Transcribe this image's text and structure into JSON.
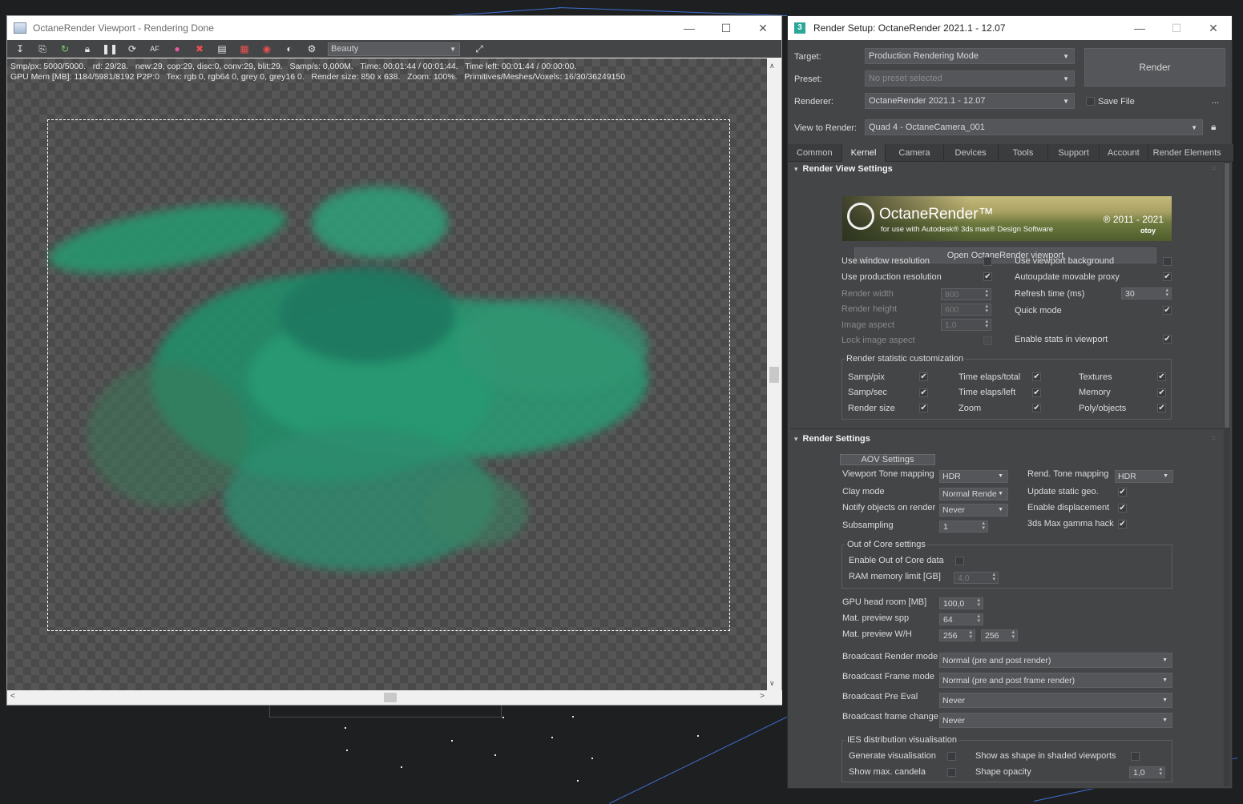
{
  "viewport": {
    "title": "OctaneRender Viewport - Rendering Done",
    "pass_select": "Beauty",
    "stats_line1": "Smp/px: 5000/5000.   rd: 29/28.   new:29, cop:29, disc:0, conv:29, blit:29.   Samp/s: 0,000M.   Time: 00:01:44 / 00:01:44.   Time left: 00:01:44 / 00:00:00.",
    "stats_line2": "GPU Mem [MB]: 1184/5981/8192 P2P:0   Tex: rgb 0, rgb64 0, grey 0, grey16 0.   Render size: 850 x 638.   Zoom: 100%.   Primitives/Meshes/Voxels: 16/30/36249150",
    "toolbar_icons": [
      "save-icon",
      "copy-icon",
      "refresh-icon",
      "lock-icon",
      "pause-icon",
      "restart-icon",
      "aa-icon",
      "color-icon",
      "region-icon",
      "display-icon",
      "film-icon",
      "camera-icon",
      "material-icon",
      "settings-icon",
      "zoom-fit-icon"
    ]
  },
  "render_setup": {
    "title": "Render Setup: OctaneRender 2021.1 - 12.07",
    "target_label": "Target:",
    "target_value": "Production Rendering Mode",
    "preset_label": "Preset:",
    "preset_value": "No preset selected",
    "renderer_label": "Renderer:",
    "renderer_value": "OctaneRender 2021.1 - 12.07",
    "view_label": "View to Render:",
    "view_value": "Quad 4 - OctaneCamera_001",
    "render_button": "Render",
    "save_file": "Save File",
    "more": "...",
    "tabs": [
      "Common",
      "Kernel",
      "Camera",
      "Devices",
      "Tools",
      "Support",
      "Account",
      "Render Elements"
    ],
    "active_tab": "Kernel",
    "rv_section": "Render View Settings",
    "banner_title": "OctaneRender™",
    "banner_sub": "for use with Autodesk® 3ds max® Design Software",
    "banner_years": "® 2011 - 2021",
    "banner_brand": "otoy",
    "open_viewport": "Open OctaneRender viewport",
    "rv": {
      "use_window_res": "Use window resolution",
      "use_prod_res": "Use production resolution",
      "render_width": "Render width",
      "render_width_val": "800",
      "render_height": "Render height",
      "render_height_val": "600",
      "image_aspect": "Image aspect",
      "image_aspect_val": "1,0",
      "lock_aspect": "Lock image aspect",
      "use_vp_bg": "Use viewport background",
      "autoupdate": "Autoupdate movable proxy",
      "refresh_time": "Refresh time (ms)",
      "refresh_val": "30",
      "quick_mode": "Quick mode",
      "enable_stats": "Enable stats in viewport"
    },
    "stat_group": "Render statistic customization",
    "stats": {
      "samp_pix": "Samp/pix",
      "samp_sec": "Samp/sec",
      "render_size": "Render size",
      "time_total": "Time elaps/total",
      "time_left": "Time elaps/left",
      "zoom": "Zoom",
      "textures": "Textures",
      "memory": "Memory",
      "poly": "Poly/objects"
    },
    "rs_section": "Render Settings",
    "aov": "AOV Settings",
    "rs": {
      "vp_tone": "Viewport Tone mapping",
      "vp_tone_val": "HDR",
      "clay": "Clay mode",
      "clay_val": "Normal Rende",
      "notify": "Notify objects on render",
      "notify_val": "Never",
      "subsampling": "Subsampling",
      "subsampling_val": "1",
      "rend_tone": "Rend. Tone mapping",
      "rend_tone_val": "HDR",
      "update_static": "Update static geo.",
      "enable_disp": "Enable displacement",
      "gamma_hack": "3ds Max gamma hack"
    },
    "ooc_group": "Out of Core settings",
    "ooc_enable": "Enable Out of Core data",
    "ooc_ram": "RAM memory limit [GB]",
    "ooc_ram_val": "4,0",
    "gpu_headroom": "GPU head room [MB]",
    "gpu_headroom_val": "100,0",
    "mat_spp": "Mat. preview spp",
    "mat_spp_val": "64",
    "mat_wh": "Mat. preview W/H",
    "mat_w_val": "256",
    "mat_h_val": "256",
    "bc_render": "Broadcast Render mode",
    "bc_render_val": "Normal (pre and post render)",
    "bc_frame": "Broadcast Frame mode",
    "bc_frame_val": "Normal (pre and post frame render)",
    "bc_pre": "Broadcast Pre Eval",
    "bc_pre_val": "Never",
    "bc_change": "Broadcast frame change",
    "bc_change_val": "Never",
    "ies_group": "IES distribution visualisation",
    "ies_gen": "Generate visualisation",
    "ies_max": "Show max. candela",
    "ies_shape": "Show as shape in shaded viewports",
    "ies_opacity": "Shape opacity",
    "ies_opacity_val": "1,0"
  }
}
